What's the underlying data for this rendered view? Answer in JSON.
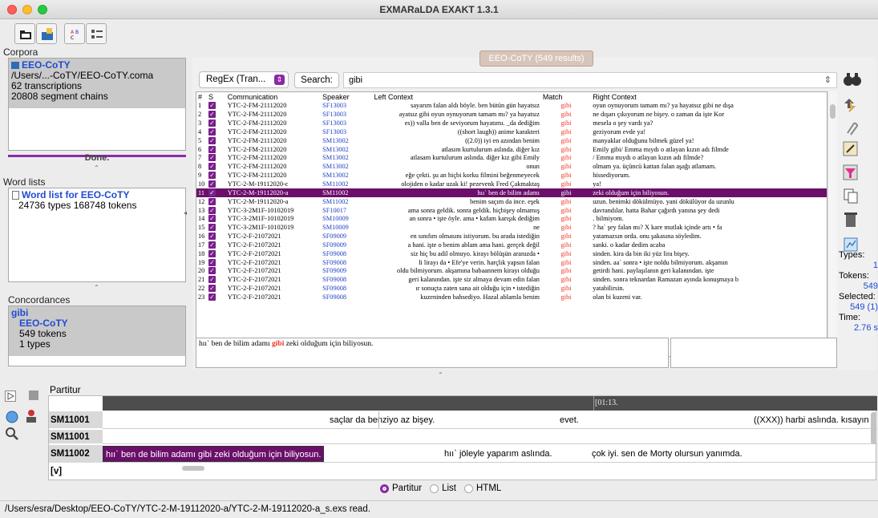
{
  "window": {
    "title": "EXMARaLDA EXAKT 1.3.1"
  },
  "colors": {
    "accent": "#6b0f6b",
    "match": "#e32222",
    "speaker": "#1f3fc2",
    "link_blue": "#1f4bd1"
  },
  "corpora": {
    "title": "Corpora",
    "name": "EEO-CoTY",
    "path": "/Users/...-CoTY/EEO-CoTY.coma",
    "transcriptions": "62 transcriptions",
    "chains": "20808 segment chains",
    "progress_label": "Done."
  },
  "wordlists": {
    "title": "Word lists",
    "item_label": "Word list for EEO-CoTY",
    "stats": "24736 types   168748 tokens"
  },
  "concordances": {
    "title": "Concordances",
    "query": "gibi",
    "corpus": "EEO-CoTY",
    "tokens": "549 tokens",
    "types": "1 types"
  },
  "results": {
    "badge": "EEO-CoTY (549 results)"
  },
  "search": {
    "mode": "RegEx (Tran...",
    "button": "Search:",
    "value": "gibi"
  },
  "table": {
    "headers": {
      "num": "#",
      "s": "S",
      "comm": "Communication",
      "spk": "Speaker",
      "left": "Left Context",
      "match": "Match",
      "right": "Right Context"
    },
    "rows": [
      {
        "n": "1",
        "comm": "YTC-2-FM-21112020",
        "spk": "SF13003",
        "left": "sayarım falan aldı böyle. ben bütün gün hayatsız",
        "match": "gibi",
        "right": "oyun oynuyorum tamam mı? ya hayatsız gibi ne dışa"
      },
      {
        "n": "2",
        "comm": "YTC-2-FM-21112020",
        "spk": "SF13003",
        "left": "ayatsız gibi oyun oynuyorum tamam mı? ya hayatsız",
        "match": "gibi",
        "right": "ne dışarı çıkıyorum ne bişey. o zaman da işte Kor"
      },
      {
        "n": "3",
        "comm": "YTC-2-FM-21112020",
        "spk": "SF13003",
        "left": "es)) valla ben de seviyorum hayatımı. _da dediğim",
        "match": "gibi",
        "right": "mesela o şey vardı ya?"
      },
      {
        "n": "4",
        "comm": "YTC-2-FM-21112020",
        "spk": "SF13003",
        "left": "((short laugh)) anime karakteri",
        "match": "gibi",
        "right": "geziyorum evde ya!"
      },
      {
        "n": "5",
        "comm": "YTC-2-FM-21112020",
        "spk": "SM13002",
        "left": "((2.0)) iyi en azından benim",
        "match": "gibi",
        "right": "manyaklar olduğunu bilmek güzel ya!"
      },
      {
        "n": "6",
        "comm": "YTC-2-FM-21112020",
        "spk": "SM13002",
        "left": "atlasım kurtulurum aslında. diğer kız",
        "match": "gibi",
        "right": "Emily gibi/ Emma mıydı o atlayan kızın adı filmde"
      },
      {
        "n": "7",
        "comm": "YTC-2-FM-21112020",
        "spk": "SM13002",
        "left": "atlasam kurtulurum aslında. diğer kız gibi Emily",
        "match": "gibi",
        "right": "/ Emma mıydı o atlayan kızın adı filmde?"
      },
      {
        "n": "8",
        "comm": "YTC-2-FM-21112020",
        "spk": "SM13002",
        "left": "onun",
        "match": "gibi",
        "right": "olmam ya. üçüncü kattan falan aşağı atlamam."
      },
      {
        "n": "9",
        "comm": "YTC-2-FM-21112020",
        "spk": "SM13002",
        "left": "eğe çekti. şu an hiçbi korku filmini beğenmeyecek",
        "match": "gibi",
        "right": "hissediyorum."
      },
      {
        "n": "10",
        "comm": "YTC-2-M-19112020-c",
        "spk": "SM11002",
        "left": "olojiden o kadar uzak ki! pezevenk Fred Çakmaktaş",
        "match": "gibi",
        "right": "ya!"
      },
      {
        "n": "11",
        "comm": "YTC-2-M-19112020-a",
        "spk": "SM11002",
        "left": "hıı` ben de bilim adamı",
        "match": "gibi",
        "right": "zeki olduğum için biliyosun.",
        "selected": true
      },
      {
        "n": "12",
        "comm": "YTC-2-M-19112020-a",
        "spk": "SM11002",
        "left": "benim saçım da ince. eşek",
        "match": "gibi",
        "right": "uzun. benimki dökülmüyo. yani dökülüyor da uzunlu"
      },
      {
        "n": "13",
        "comm": "YTC-3-2M1F-10102019",
        "spk": "SF10017",
        "left": "ama sonra geldik. sonra geldik. hiçbişey olmamış",
        "match": "gibi",
        "right": "davrandılar. hatta Bahar çağırdı yanına şey dedi"
      },
      {
        "n": "14",
        "comm": "YTC-3-2M1F-10102019",
        "spk": "SM10009",
        "left": "an sonra • işte öyle. ama • kafam karışık dediğim",
        "match": "gibi",
        "right": ". bilmiyom."
      },
      {
        "n": "15",
        "comm": "YTC-3-2M1F-10102019",
        "spk": "SM10009",
        "left": "ne",
        "match": "gibi",
        "right": "? ha` şey falan mı? X kare mutlak içinde artı • fa"
      },
      {
        "n": "16",
        "comm": "YTC-2-F-21072021",
        "spk": "SF09009",
        "left": "en sınıfım olmasını istiyorum. bu arada istediğin",
        "match": "gibi",
        "right": "yatamazsın orda. onu şakasına söyledim."
      },
      {
        "n": "17",
        "comm": "YTC-2-F-21072021",
        "spk": "SF09009",
        "left": "a hani. işte o benim ablam ama hani. gerçek değil",
        "match": "gibi",
        "right": "sanki. o kadar dedim acaba"
      },
      {
        "n": "18",
        "comm": "YTC-2-F-21072021",
        "spk": "SF09008",
        "left": "siz hiç bu adil olmuyo. kirayı bölüşün aranızda •",
        "match": "gibi",
        "right": "sinden. kira da bin iki yüz lira bişey."
      },
      {
        "n": "19",
        "comm": "YTC-2-F-21072021",
        "spk": "SF09008",
        "left": "li lirayı da • Efe'ye verin. harçlık yapsın falan",
        "match": "gibi",
        "right": "sinden. aa` sonra • işte noldu bilmiyorum. akşamın"
      },
      {
        "n": "20",
        "comm": "YTC-2-F-21072021",
        "spk": "SF09009",
        "left": "oldu bilmiyorum. akşamına babaannem kirayı olduğu",
        "match": "gibi",
        "right": "getirdi hani. paylaşılanın geri kalanından. işte"
      },
      {
        "n": "21",
        "comm": "YTC-2-F-21072021",
        "spk": "SF09008",
        "left": "geri kalanından. işte siz almaya devam edin falan",
        "match": "gibi",
        "right": "sinden. sonra teknardan Ramazan ayında konuşmaya b"
      },
      {
        "n": "22",
        "comm": "YTC-2-F-21072021",
        "spk": "SF09008",
        "left": "ır sonuçta zaten sana ait olduğu için • istediğin",
        "match": "gibi",
        "right": "yatabilirsin."
      },
      {
        "n": "23",
        "comm": "YTC-2-F-21072021",
        "spk": "SF09008",
        "left": "kuzeninden bahsediyo. Hazal ablamla benim",
        "match": "gibi",
        "right": "olan bi kuzeni var."
      }
    ]
  },
  "preview": {
    "before": "hıı` ben de bilim adamı ",
    "match": "gibi",
    "after": " zeki olduğum için biliyosun."
  },
  "stats": {
    "types_label": "Types:",
    "types_value": "1",
    "tokens_label": "Tokens:",
    "tokens_value": "549",
    "selected_label": "Selected:",
    "selected_value": "549 (1)",
    "time_label": "Time:",
    "time_value": "2.76 s"
  },
  "partitur": {
    "title": "Partitur",
    "timestamp": "[01:13.",
    "tiers": [
      {
        "label": "SM11001 [v]",
        "segments": [
          "saçlar da benziyo az bişey.",
          "evet.",
          "((XXX)) harbi aslında. kısayın"
        ]
      },
      {
        "label": "SM11001 [a]",
        "segments": []
      },
      {
        "label": "SM11002 [v]",
        "segments": [
          "hıı` ben de bilim adamı gibi zeki olduğum için biliyosun.",
          "hıı` jöleyle yaparım aslında.",
          "çok iyi. sen de Morty olursun yanımda."
        ]
      }
    ]
  },
  "view_options": {
    "partitur": "Partitur",
    "list": "List",
    "html": "HTML",
    "selected": "Partitur"
  },
  "status_bar": "/Users/esra/Desktop/EEO-CoTY/YTC-2-M-19112020-a/YTC-2-M-19112020-a_s.exs read."
}
